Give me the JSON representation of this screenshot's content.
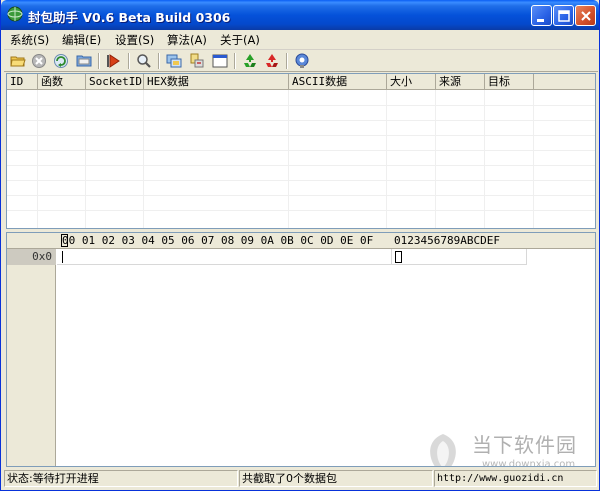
{
  "window": {
    "title": "封包助手 V0.6 Beta Build 0306"
  },
  "menu": [
    {
      "label": "系统(S)"
    },
    {
      "label": "编辑(E)"
    },
    {
      "label": "设置(S)"
    },
    {
      "label": "算法(A)"
    },
    {
      "label": "关于(A)"
    }
  ],
  "toolbar_icons": [
    "open-folder-icon",
    "stop-icon",
    "refresh-icon",
    "folder-icon",
    "play-icon",
    "search-icon",
    "network-icon",
    "filter-icon",
    "window-icon",
    "recycle-green-icon",
    "recycle-red-icon",
    "settings-icon"
  ],
  "packet_table": {
    "columns": [
      "ID",
      "函数",
      "SocketID",
      "HEX数据",
      "ASCII数据",
      "大小",
      "来源",
      "目标"
    ]
  },
  "hex_view": {
    "columns_header": "00 01 02 03 04 05 06 07 08 09 0A 0B 0C 0D 0E 0F",
    "ascii_header": "0123456789ABCDEF",
    "offset": "0x0"
  },
  "status": {
    "state": "状态:等待打开进程",
    "captured": "共截取了0个数据包",
    "url": "http://www.guozidi.cn"
  },
  "watermark": {
    "text": "当下软件园",
    "url": "www.downxia.com"
  }
}
